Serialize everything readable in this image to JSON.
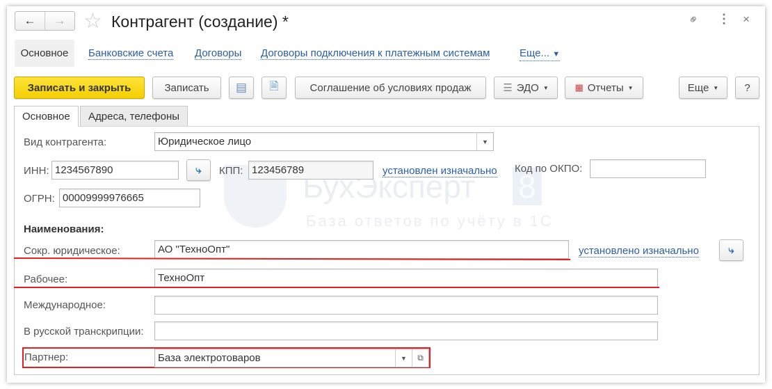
{
  "window": {
    "title": "Контрагент (создание) *"
  },
  "nav_tabs": [
    {
      "label": "Основное",
      "active": true
    },
    {
      "label": "Банковские счета"
    },
    {
      "label": "Договоры"
    },
    {
      "label": "Договоры подключения к платежным системам"
    },
    {
      "label": "Еще..."
    }
  ],
  "toolbar": {
    "save_close": "Записать и закрыть",
    "save": "Записать",
    "agreement": "Соглашение об условиях продаж",
    "edo": "ЭДО",
    "reports": "Отчеты",
    "more": "Еще",
    "help": "?"
  },
  "form_tabs": [
    {
      "label": "Основное",
      "active": true
    },
    {
      "label": "Адреса, телефоны"
    }
  ],
  "fields": {
    "kind_label": "Вид контрагента:",
    "kind_value": "Юридическое лицо",
    "inn_label": "ИНН:",
    "inn_value": "1234567890",
    "kpp_label": "КПП:",
    "kpp_value": "123456789",
    "kpp_link": "установлен изначально",
    "okpo_label": "Код по ОКПО:",
    "okpo_value": "",
    "ogrn_label": "ОГРН:",
    "ogrn_value": "00009999976665",
    "names_heading": "Наименования:",
    "short_label": "Сокр. юридическое:",
    "short_value": "АО \"ТехноОпт\"",
    "short_link": "установлено изначально",
    "work_label": "Рабочее:",
    "work_value": "ТехноОпт",
    "intl_label": "Международное:",
    "intl_value": "",
    "translit_label": "В русской транскрипции:",
    "translit_value": "",
    "partner_label": "Партнер:",
    "partner_value": "База электротоваров"
  },
  "watermark": {
    "brand": "БухЭксперт",
    "number": "8",
    "tagline": "База ответов по учёту в 1С"
  },
  "colors": {
    "accent_yellow": "#f7d514",
    "link": "#2b5ea8",
    "highlight_red": "#e52020"
  }
}
